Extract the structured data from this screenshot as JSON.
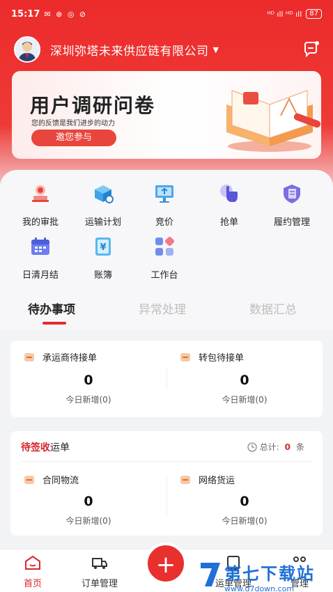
{
  "status_bar": {
    "time": "15:17",
    "left_icons": "✉ ⊗ ◎ ⊘",
    "right_icons": "ᴴᴰ ıll ᴴᴰ ıll",
    "battery": "87"
  },
  "header": {
    "company": "深圳弥塔未来供应链有限公司"
  },
  "banner": {
    "title": "用户调研问卷",
    "subtitle": "您的反馈是我们进步的动力",
    "button": "邀您参与"
  },
  "menu": [
    {
      "label": "我的审批",
      "icon": "approval-icon"
    },
    {
      "label": "运输计划",
      "icon": "transport-plan-icon"
    },
    {
      "label": "竞价",
      "icon": "bidding-icon"
    },
    {
      "label": "抢单",
      "icon": "grab-order-icon"
    },
    {
      "label": "履约管理",
      "icon": "fulfillment-icon"
    },
    {
      "label": "日清月结",
      "icon": "settlement-calendar-icon"
    },
    {
      "label": "账簿",
      "icon": "ledger-icon"
    },
    {
      "label": "工作台",
      "icon": "workbench-icon"
    }
  ],
  "tabs": [
    {
      "label": "待办事项",
      "active": true
    },
    {
      "label": "异常处理",
      "active": false
    },
    {
      "label": "数据汇总",
      "active": false
    }
  ],
  "todo_card": {
    "items": [
      {
        "title": "承运商待接单",
        "count": "0",
        "sub": "今日新增(0)"
      },
      {
        "title": "转包待接单",
        "count": "0",
        "sub": "今日新增(0)"
      }
    ]
  },
  "sign_card": {
    "title_red": "待签收",
    "title_rest": "运单",
    "total_label": "总计:",
    "total_value": "0",
    "total_unit": "条",
    "items": [
      {
        "title": "合同物流",
        "count": "0",
        "sub": "今日新增(0)"
      },
      {
        "title": "网络货运",
        "count": "0",
        "sub": "今日新增(0)"
      }
    ]
  },
  "bottom_nav": {
    "home": "首页",
    "orders": "订单管理",
    "fab": "+",
    "item4": "运单管理",
    "item5": "管理"
  },
  "watermark": {
    "text": "第七下载站",
    "url": "www.d7down.com"
  },
  "colors": {
    "primary_red": "#e32c2c",
    "accent_orange": "#e6702a"
  }
}
